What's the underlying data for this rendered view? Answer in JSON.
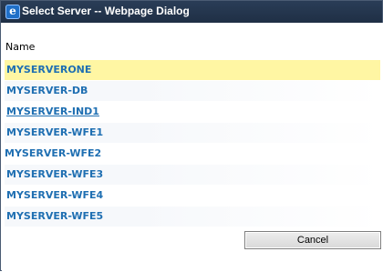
{
  "window": {
    "title": "Select Server -- Webpage Dialog",
    "icon": "ie-icon"
  },
  "list": {
    "column_header": "Name",
    "servers": [
      {
        "name": "MYSERVERONE",
        "selected": true
      },
      {
        "name": "MYSERVER-DB"
      },
      {
        "name": "MYSERVER-IND1",
        "underlined": true
      },
      {
        "name": "MYSERVER-WFE1"
      },
      {
        "name": "MYSERVER-WFE2"
      },
      {
        "name": "MYSERVER-WFE3"
      },
      {
        "name": "MYSERVER-WFE4"
      },
      {
        "name": "MYSERVER-WFE5"
      }
    ]
  },
  "buttons": {
    "cancel_label": "Cancel"
  },
  "colors": {
    "link": "#1f6fb2",
    "selected_row": "#fff6a3",
    "titlebar": "#23354e"
  }
}
